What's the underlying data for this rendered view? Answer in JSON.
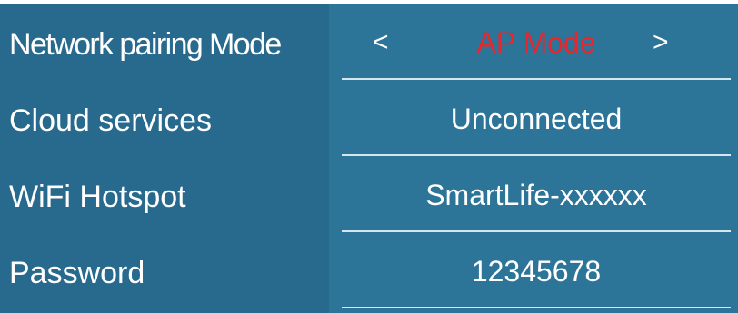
{
  "rows": [
    {
      "label": "Network pairing Mode",
      "value": "AP Mode",
      "prev": "<",
      "next": ">"
    },
    {
      "label": "Cloud services",
      "value": "Unconnected"
    },
    {
      "label": "WiFi Hotspot",
      "value": "SmartLife-xxxxxx"
    },
    {
      "label": "Password",
      "value": "12345678"
    }
  ],
  "colors": {
    "panel": "#2d7499",
    "label_column": "#286a8d",
    "mode_value": "#e8262b",
    "text": "#ffffff"
  }
}
